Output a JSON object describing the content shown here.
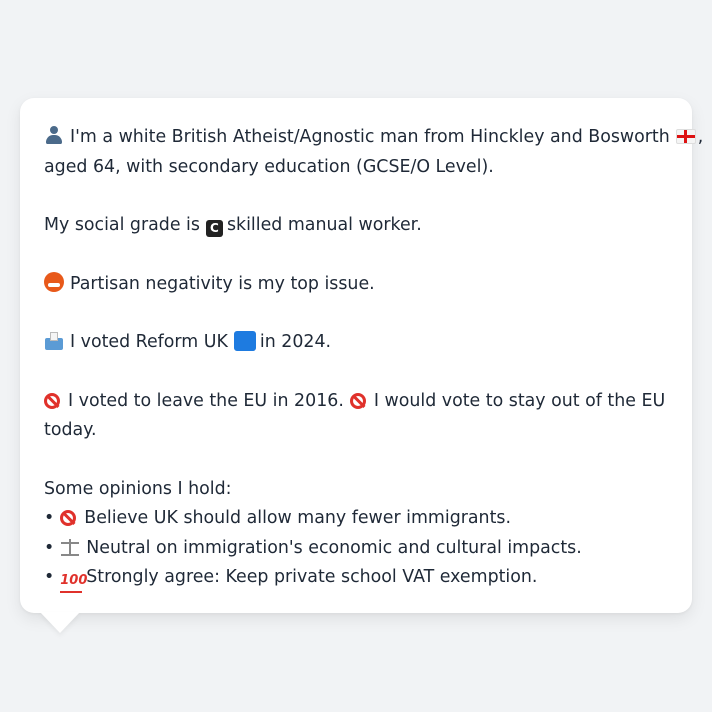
{
  "card": {
    "intro_line1": "I'm a white British Atheist/Agnostic man from Hinckley and Bosworth",
    "intro_line1_end": ",",
    "intro_line2": "aged 64, with secondary education (GCSE/O Level).",
    "grade_prefix": "My social grade is",
    "grade_suffix": "skilled manual worker.",
    "grade_letter": "C",
    "issue": "Partisan negativity is my top issue.",
    "vote_prefix": "I voted Reform UK",
    "vote_suffix": "in 2024.",
    "eu_part1": "I voted to leave the EU in 2016.",
    "eu_part2": "I would vote to stay out of the EU",
    "eu_line2": "today.",
    "opinions_heading": "Some opinions I hold:",
    "opinions": [
      {
        "bullet": "•",
        "icon": "no-entry-icon",
        "text": "Believe UK should allow many fewer immigrants."
      },
      {
        "bullet": "•",
        "icon": "scales-icon",
        "text": "Neutral on immigration's economic and cultural impacts."
      },
      {
        "bullet": "•",
        "icon": "hundred-points-icon",
        "text": "Strongly agree: Keep private school VAT exemption."
      }
    ]
  },
  "colors": {
    "background": "#f1f3f5",
    "card": "#ffffff",
    "text": "#1f2937",
    "party_blue": "#1e7be0"
  }
}
